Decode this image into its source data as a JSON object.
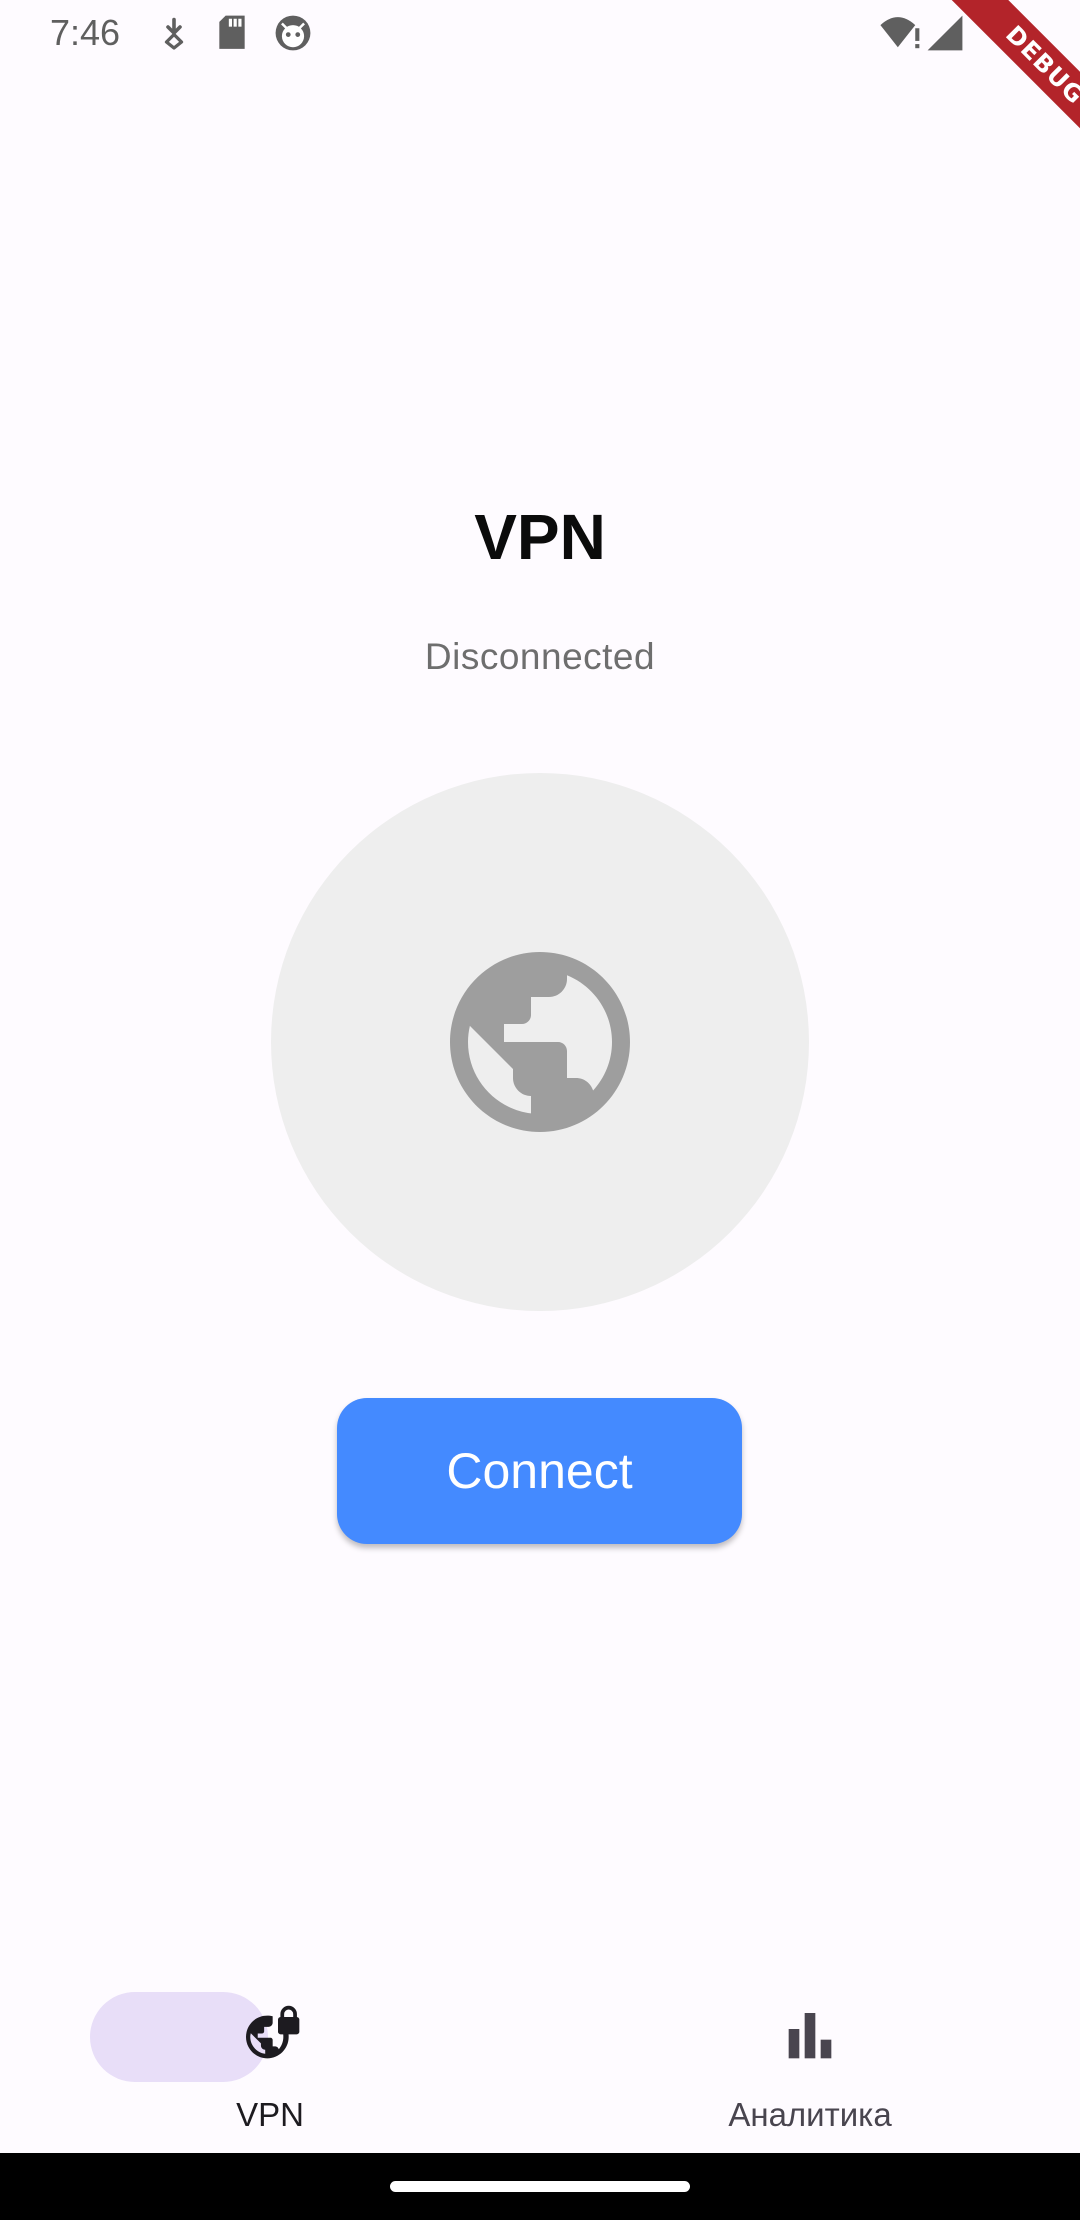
{
  "status_bar": {
    "time": "7:46",
    "icons": [
      "download-icon",
      "sd-card-icon",
      "android-debug-icon",
      "wifi-alert-icon",
      "signal-icon"
    ]
  },
  "debug_banner": {
    "label": "DEBUG"
  },
  "main": {
    "title": "VPN",
    "status": "Disconnected",
    "center_icon": "globe-icon",
    "connect_label": "Connect"
  },
  "bottom_nav": {
    "items": [
      {
        "label": "VPN",
        "icon": "globe-lock-icon",
        "active": true
      },
      {
        "label": "Аналитика",
        "icon": "bar-chart-icon",
        "active": false
      }
    ]
  },
  "colors": {
    "accent": "#448aff",
    "nav_indicator": "#e8def8",
    "debug_banner": "#b3242a",
    "globe_bg": "#eeeeee",
    "globe_icon": "#9e9e9e"
  }
}
